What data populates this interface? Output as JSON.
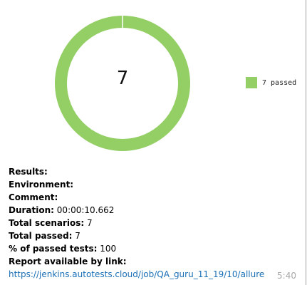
{
  "chart_data": {
    "type": "pie",
    "center_label": "7",
    "slices": [
      {
        "name": "7 passed",
        "value": 7,
        "color": "#94cf66"
      }
    ],
    "legend_position": "right"
  },
  "report": {
    "results_label": "Results:",
    "environment_label": "Environment:",
    "comment_label": "Comment:",
    "duration_label": "Duration:",
    "duration_value": "00:00:10.662",
    "total_scenarios_label": "Total scenarios:",
    "total_scenarios_value": "7",
    "total_passed_label": "Total passed:",
    "total_passed_value": "7",
    "percent_passed_label": "% of passed tests:",
    "percent_passed_value": "100",
    "report_link_label": "Report available by link:",
    "report_link_url": "https://jenkins.autotests.cloud/job/QA_guru_11_19/10/allure"
  },
  "message": {
    "time": "5:40"
  }
}
